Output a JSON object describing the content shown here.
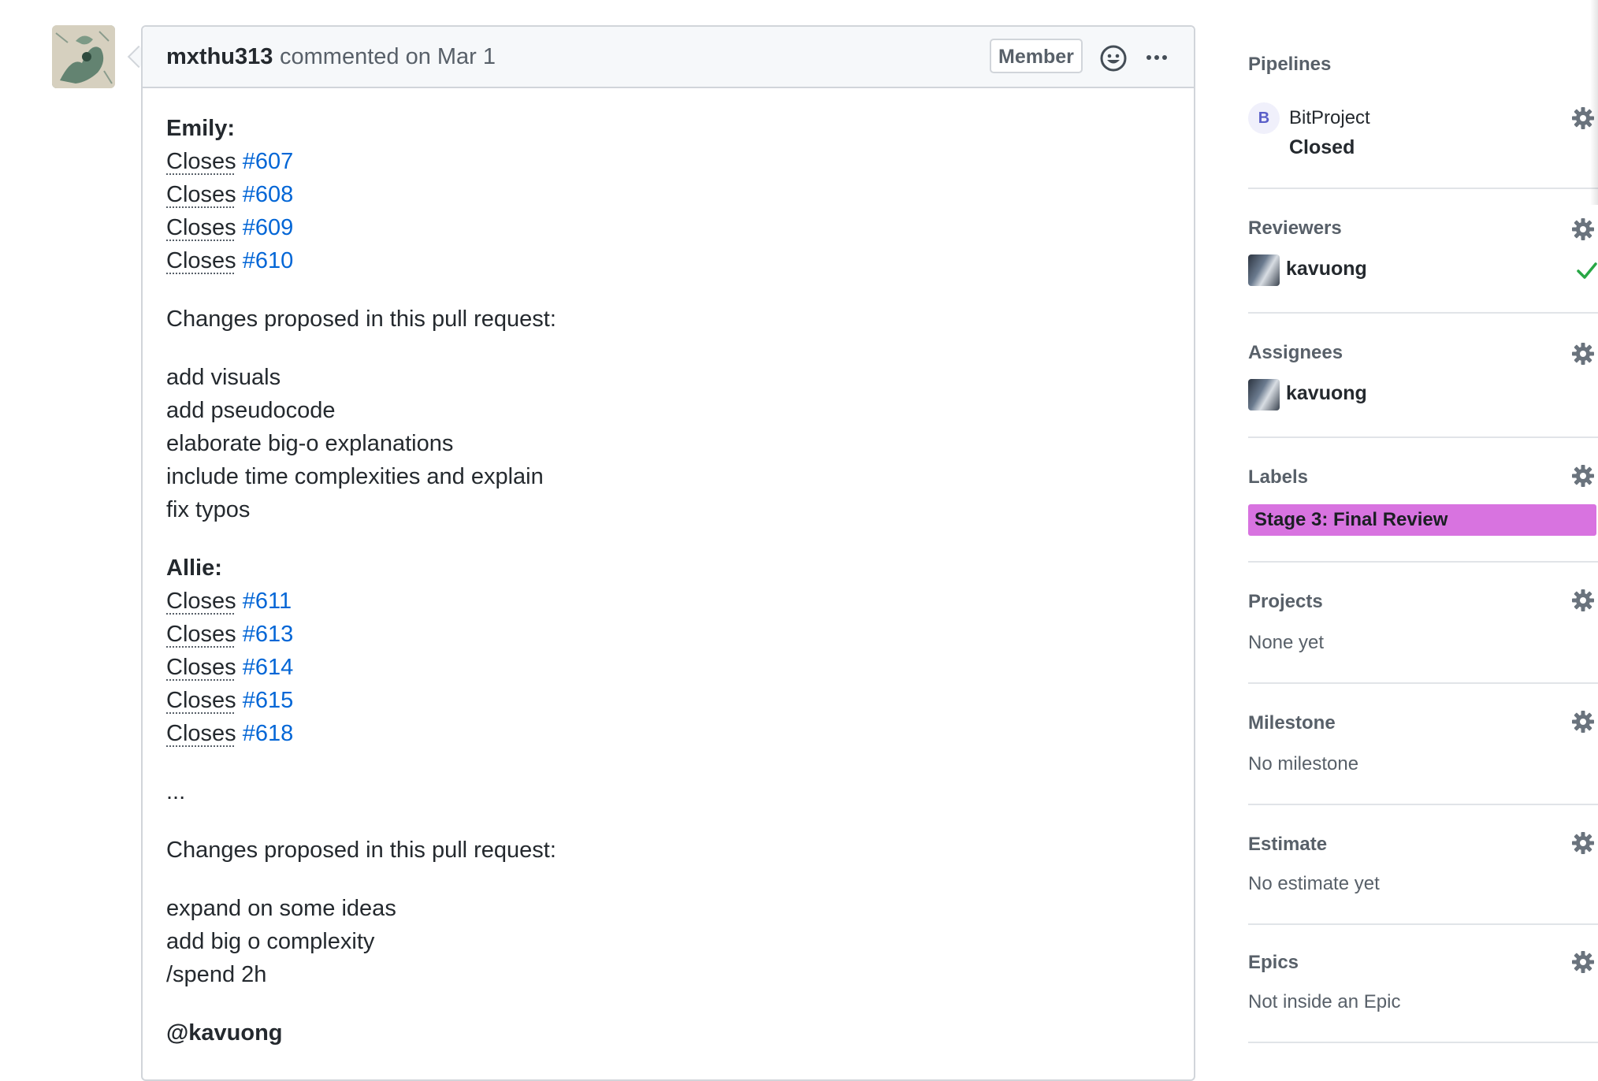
{
  "comment": {
    "author": "mxthu313",
    "meta": "commented on Mar 1",
    "badge": "Member",
    "body": {
      "emily_heading": "Emily:",
      "emily_closes": [
        {
          "word": "Closes",
          "issue": "#607"
        },
        {
          "word": "Closes",
          "issue": "#608"
        },
        {
          "word": "Closes",
          "issue": "#609"
        },
        {
          "word": "Closes",
          "issue": "#610"
        }
      ],
      "changes_heading_1": "Changes proposed in this pull request:",
      "changes_1": [
        "add visuals",
        "add pseudocode",
        "elaborate big-o explanations",
        "include time complexities and explain",
        "fix typos"
      ],
      "allie_heading": "Allie:",
      "allie_closes": [
        {
          "word": "Closes",
          "issue": "#611"
        },
        {
          "word": "Closes",
          "issue": "#613"
        },
        {
          "word": "Closes",
          "issue": "#614"
        },
        {
          "word": "Closes",
          "issue": "#615"
        },
        {
          "word": "Closes",
          "issue": "#618"
        }
      ],
      "ellipsis": "...",
      "changes_heading_2": "Changes proposed in this pull request:",
      "changes_2": [
        "expand on some ideas",
        "add big o complexity",
        "/spend 2h"
      ],
      "mention": "@kavuong"
    }
  },
  "sidebar": {
    "pipelines": {
      "title": "Pipelines",
      "badge_letter": "B",
      "name": "BitProject",
      "status": "Closed"
    },
    "reviewers": {
      "title": "Reviewers",
      "user": "kavuong"
    },
    "assignees": {
      "title": "Assignees",
      "user": "kavuong"
    },
    "labels": {
      "title": "Labels",
      "label": "Stage 3: Final Review",
      "label_color": "#d873e0"
    },
    "projects": {
      "title": "Projects",
      "value": "None yet"
    },
    "milestone": {
      "title": "Milestone",
      "value": "No milestone"
    },
    "estimate": {
      "title": "Estimate",
      "value": "No estimate yet"
    },
    "epics": {
      "title": "Epics",
      "value": "Not inside an Epic"
    }
  },
  "colors": {
    "link": "#0366d6",
    "check": "#28a745",
    "label": "#d873e0"
  },
  "icons": [
    "smiley-icon",
    "kebab-icon",
    "gear-icon",
    "check-icon"
  ]
}
